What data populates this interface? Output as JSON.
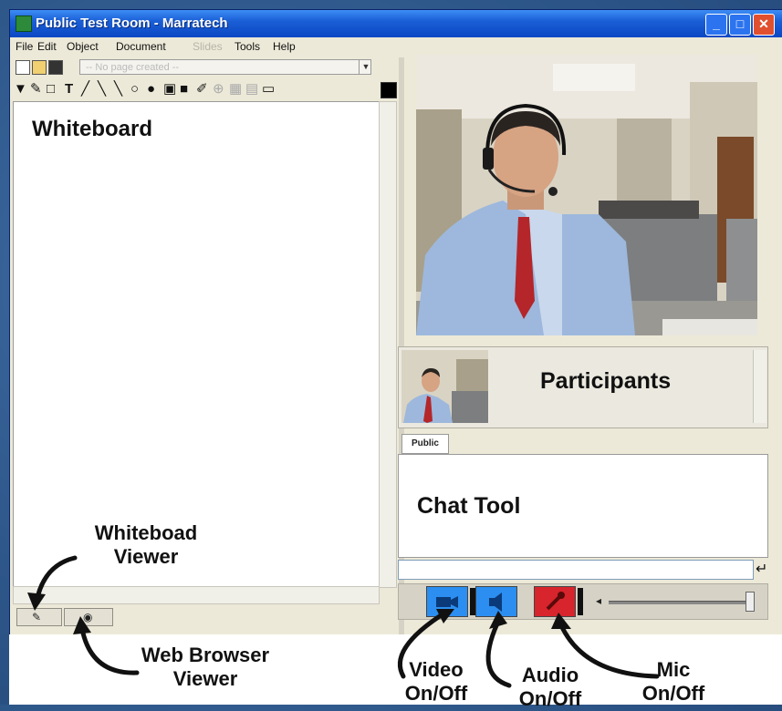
{
  "window": {
    "title": "Public Test Room - Marratech"
  },
  "menu": [
    "File",
    "Edit",
    "Object",
    "Document",
    "Slides",
    "Tools",
    "Help"
  ],
  "toolbar": {
    "page_placeholder": "-- No page created --"
  },
  "whiteboard": {
    "title": "Whiteboard"
  },
  "participants": {
    "title": "Participants"
  },
  "chat": {
    "tab": "Public",
    "title": "Chat Tool"
  },
  "annotations": {
    "whiteboard_viewer": [
      "Whiteboad",
      "Viewer"
    ],
    "web_browser_viewer": [
      "Web Browser",
      "Viewer"
    ],
    "video": [
      "Video",
      "On/Off"
    ],
    "audio": [
      "Audio",
      "On/Off"
    ],
    "mic": [
      "Mic",
      "On/Off"
    ]
  },
  "colors": {
    "titlebar": "#0b47c4",
    "video_button": "#2b8ef0",
    "mic_button": "#d8242c"
  },
  "icons": [
    "app-icon",
    "minimize-icon",
    "maximize-icon",
    "close-icon",
    "new-icon",
    "open-icon",
    "save-icon",
    "select-arrow-icon",
    "text-tool-icon",
    "line-tool-icon",
    "circle-tool-icon",
    "rect-tool-icon",
    "pencil-icon",
    "whiteboard-tab-icon",
    "web-browser-tab-icon",
    "video-camera-icon",
    "speaker-icon",
    "mic-icon",
    "enter-icon"
  ]
}
